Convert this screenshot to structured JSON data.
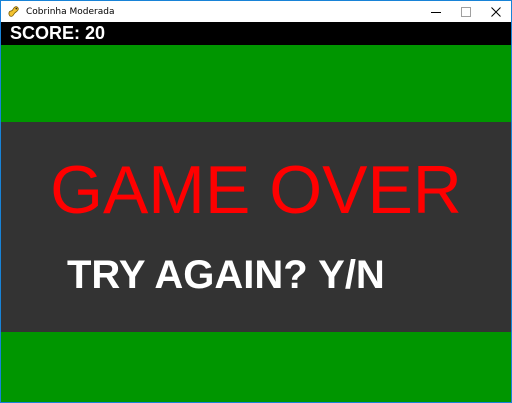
{
  "window": {
    "title": "Cobrinha Moderada",
    "app_icon": "pygame-snake-icon",
    "controls": [
      "minimize-icon",
      "maximize-icon",
      "close-icon"
    ]
  },
  "hud": {
    "score_text": "SCORE: 20"
  },
  "overlay": {
    "title": "GAME OVER",
    "prompt": "TRY AGAIN? Y/N"
  },
  "colors": {
    "field": "#009600",
    "hud_bar": "#000000",
    "overlay_panel": "#333333",
    "game_over_text": "#ff0000",
    "prompt_text": "#ffffff",
    "window_border": "#1883d7"
  }
}
